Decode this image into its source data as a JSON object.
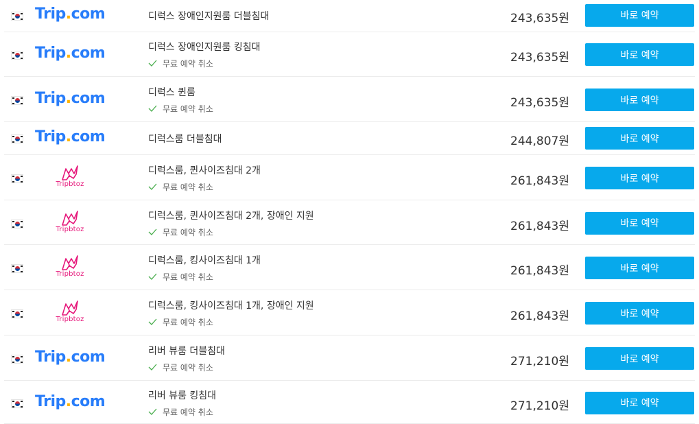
{
  "offers": [
    {
      "provider": "tripcom",
      "provider_name": "Trip.com",
      "room": "디럭스 장애인지원룸 더블침대",
      "free_cancel": false,
      "free_cancel_label": "",
      "price": "243,635원",
      "button": "바로 예약"
    },
    {
      "provider": "tripcom",
      "provider_name": "Trip.com",
      "room": "디럭스 장애인지원룸 킹침대",
      "free_cancel": true,
      "free_cancel_label": "무료 예약 취소",
      "price": "243,635원",
      "button": "바로 예약"
    },
    {
      "provider": "tripcom",
      "provider_name": "Trip.com",
      "room": "디럭스 퀸룸",
      "free_cancel": true,
      "free_cancel_label": "무료 예약 취소",
      "price": "243,635원",
      "button": "바로 예약"
    },
    {
      "provider": "tripcom",
      "provider_name": "Trip.com",
      "room": "디럭스룸 더블침대",
      "free_cancel": false,
      "free_cancel_label": "",
      "price": "244,807원",
      "button": "바로 예약"
    },
    {
      "provider": "tripbtoz",
      "provider_name": "Tripbtoz",
      "room": "디럭스룸, 퀸사이즈침대 2개",
      "free_cancel": true,
      "free_cancel_label": "무료 예약 취소",
      "price": "261,843원",
      "button": "바로 예약"
    },
    {
      "provider": "tripbtoz",
      "provider_name": "Tripbtoz",
      "room": "디럭스룸, 퀸사이즈침대 2개, 장애인 지원",
      "free_cancel": true,
      "free_cancel_label": "무료 예약 취소",
      "price": "261,843원",
      "button": "바로 예약"
    },
    {
      "provider": "tripbtoz",
      "provider_name": "Tripbtoz",
      "room": "디럭스룸, 킹사이즈침대 1개",
      "free_cancel": true,
      "free_cancel_label": "무료 예약 취소",
      "price": "261,843원",
      "button": "바로 예약"
    },
    {
      "provider": "tripbtoz",
      "provider_name": "Tripbtoz",
      "room": "디럭스룸, 킹사이즈침대 1개, 장애인 지원",
      "free_cancel": true,
      "free_cancel_label": "무료 예약 취소",
      "price": "261,843원",
      "button": "바로 예약"
    },
    {
      "provider": "tripcom",
      "provider_name": "Trip.com",
      "room": "리버 뷰룸 더블침대",
      "free_cancel": true,
      "free_cancel_label": "무료 예약 취소",
      "price": "271,210원",
      "button": "바로 예약"
    },
    {
      "provider": "tripcom",
      "provider_name": "Trip.com",
      "room": "리버 뷰룸 킹침대",
      "free_cancel": true,
      "free_cancel_label": "무료 예약 취소",
      "price": "271,210원",
      "button": "바로 예약"
    }
  ],
  "icons": {
    "flag": "south-korea-flag-icon",
    "check": "check-icon"
  },
  "colors": {
    "tripcom": "#287dfa",
    "tripcom_dot": "#ffb400",
    "tripbtoz": "#e6167a",
    "button": "#07a9ec",
    "check": "#4caf50"
  }
}
